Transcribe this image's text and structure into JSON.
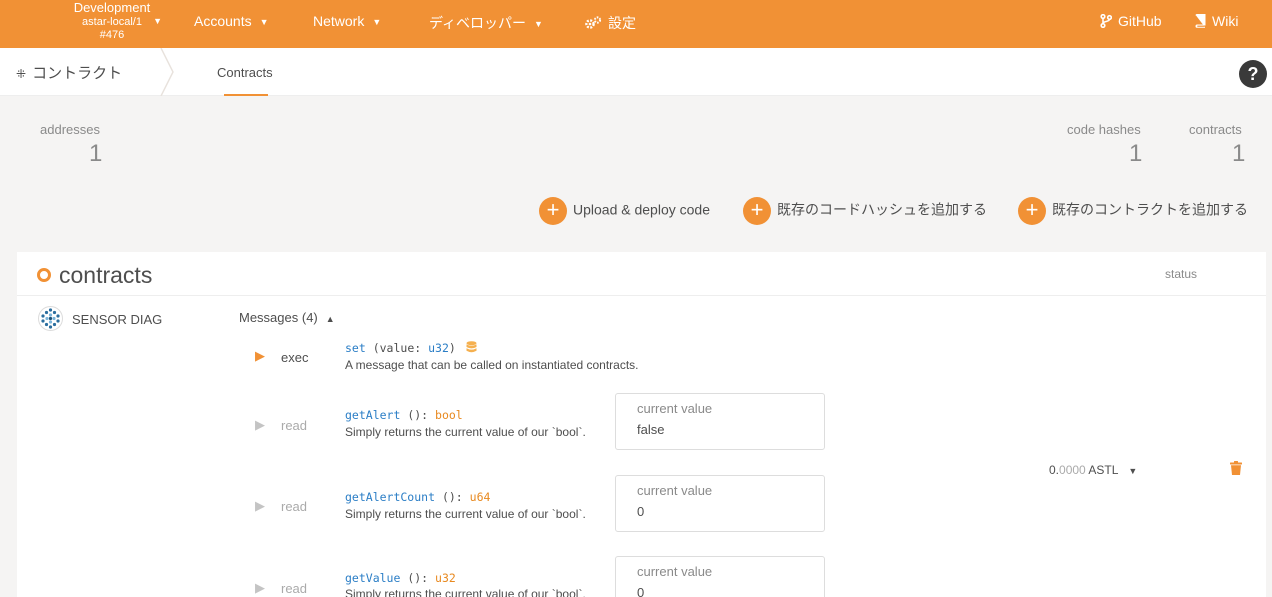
{
  "header": {
    "chain": {
      "name": "Development",
      "network": "astar-local/1",
      "block": "#476"
    },
    "nav": [
      {
        "label": "Accounts"
      },
      {
        "label": "Network"
      },
      {
        "label": "ディベロッパー"
      },
      {
        "label": "設定"
      }
    ],
    "links": [
      {
        "label": "GitHub"
      },
      {
        "label": "Wiki"
      }
    ],
    "accent_color": "#f19135"
  },
  "subheader": {
    "section": "コントラクト",
    "tab": "Contracts",
    "help": "?"
  },
  "summary": {
    "addresses": {
      "label": "addresses",
      "value": "1"
    },
    "code_hashes": {
      "label": "code hashes",
      "value": "1"
    },
    "contracts": {
      "label": "contracts",
      "value": "1"
    }
  },
  "actions": {
    "upload": "Upload & deploy code",
    "add_hash": "既存のコードハッシュを追加する",
    "add_contract": "既存のコントラクトを追加する"
  },
  "table": {
    "title": "contracts",
    "status_header": "status",
    "contract": {
      "name": "SENSOR DIAG",
      "messages_label": "Messages (4)",
      "messages": [
        {
          "kind": "exec",
          "name": "set",
          "params_open": " (value: ",
          "param_type": "u32",
          "params_close": ")",
          "description": "A message that can be called on instantiated contracts."
        },
        {
          "kind": "read",
          "name": "getAlert",
          "params": " (): ",
          "return_type": "bool",
          "description": "Simply returns the current value of our `bool`.",
          "current_label": "current value",
          "current_value": "false"
        },
        {
          "kind": "read",
          "name": "getAlertCount",
          "params": " (): ",
          "return_type": "u64",
          "description": "Simply returns the current value of our `bool`.",
          "current_label": "current value",
          "current_value": "0"
        },
        {
          "kind": "read",
          "name": "getValue",
          "params": " (): ",
          "return_type": "u32",
          "description": "Simply returns the current value of our `bool`.",
          "current_label": "current value",
          "current_value": "0"
        }
      ],
      "balance": {
        "int": "0.",
        "frac": "0000",
        "unit": " ASTL"
      }
    }
  }
}
